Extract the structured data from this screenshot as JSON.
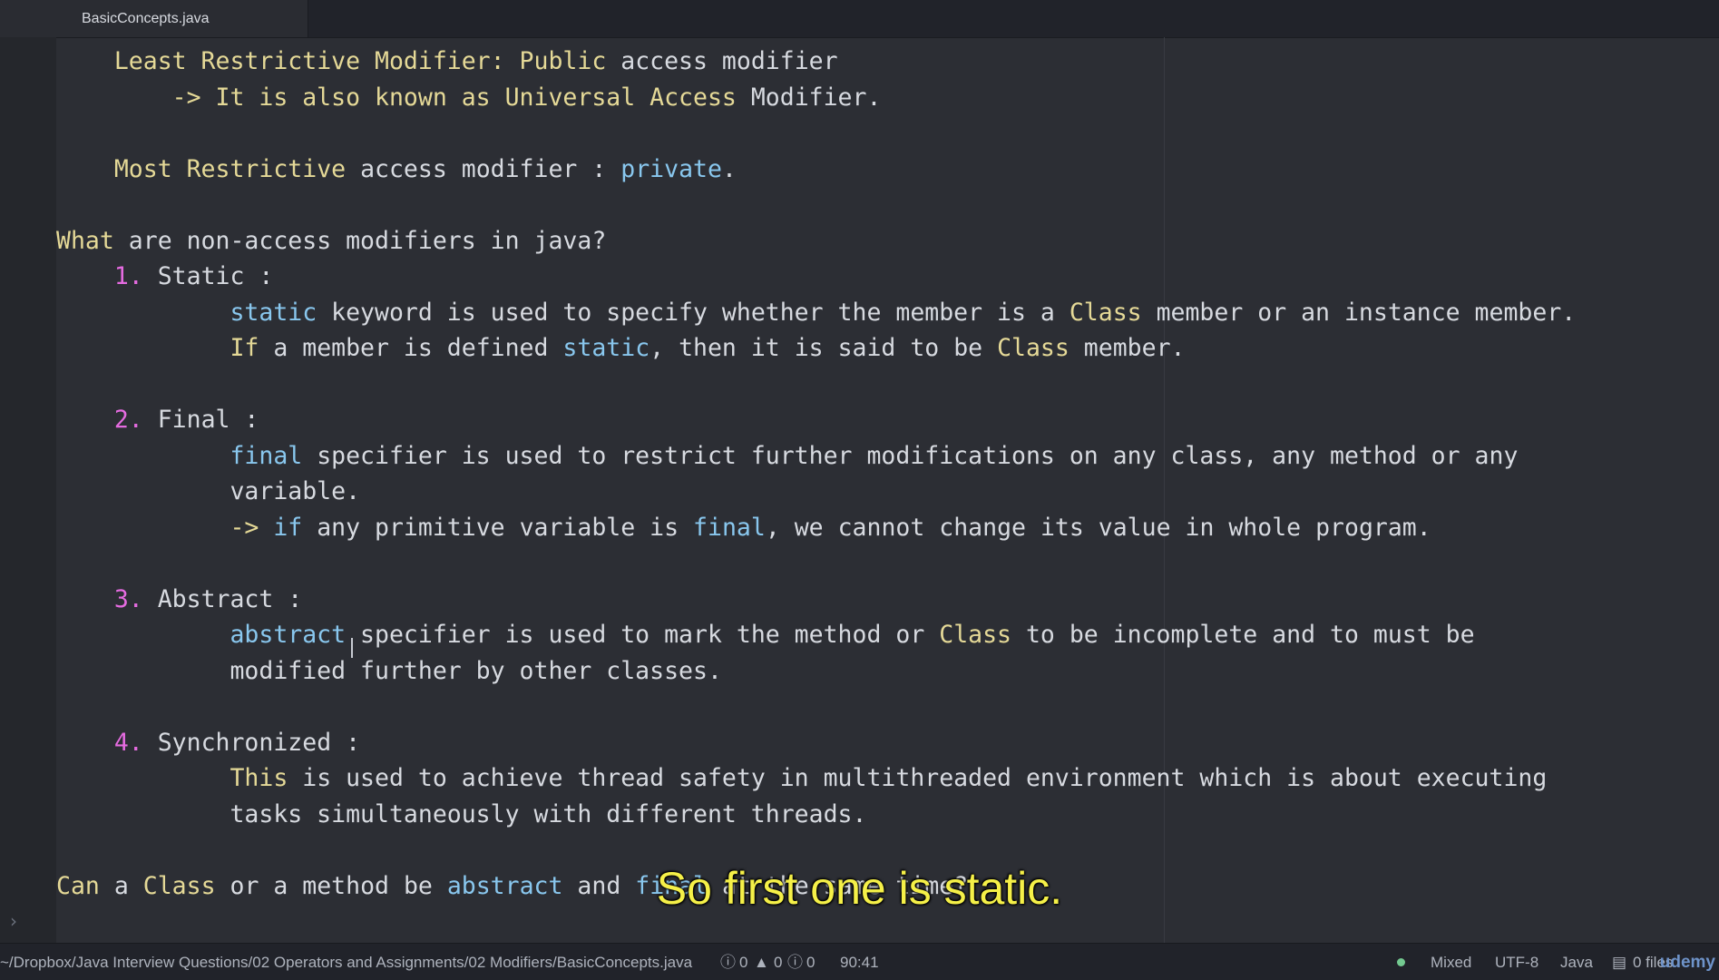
{
  "tab": {
    "title": "BasicConcepts.java"
  },
  "editor": {
    "lines": [
      {
        "segments": [
          {
            "t": "    ",
            "c": "def"
          },
          {
            "t": "Least Restrictive Modifier: Public",
            "c": "yel"
          },
          {
            "t": " access modifier",
            "c": "def"
          }
        ]
      },
      {
        "segments": [
          {
            "t": "        -> It is also known as ",
            "c": "yel"
          },
          {
            "t": "Universal Access",
            "c": "yel"
          },
          {
            "t": " Modifier.",
            "c": "def"
          }
        ]
      },
      {
        "segments": []
      },
      {
        "segments": [
          {
            "t": "    ",
            "c": "def"
          },
          {
            "t": "Most Restrictive",
            "c": "yel"
          },
          {
            "t": " access modifier : ",
            "c": "def"
          },
          {
            "t": "private",
            "c": "blue"
          },
          {
            "t": ".",
            "c": "def"
          }
        ]
      },
      {
        "segments": []
      },
      {
        "segments": [
          {
            "t": "What",
            "c": "yel"
          },
          {
            "t": " are non-access modifiers in java?",
            "c": "def"
          }
        ]
      },
      {
        "segments": [
          {
            "t": "    ",
            "c": "def"
          },
          {
            "t": "1.",
            "c": "pink"
          },
          {
            "t": " Static :",
            "c": "def"
          }
        ]
      },
      {
        "segments": [
          {
            "t": "            ",
            "c": "def"
          },
          {
            "t": "static",
            "c": "blue"
          },
          {
            "t": " keyword is used to specify whether the member is a ",
            "c": "def"
          },
          {
            "t": "Class",
            "c": "yel"
          },
          {
            "t": " member or an instance member.",
            "c": "def"
          }
        ]
      },
      {
        "segments": [
          {
            "t": "            ",
            "c": "def"
          },
          {
            "t": "If",
            "c": "yel"
          },
          {
            "t": " a member is defined ",
            "c": "def"
          },
          {
            "t": "static",
            "c": "blue"
          },
          {
            "t": ", then it is said to be ",
            "c": "def"
          },
          {
            "t": "Class",
            "c": "yel"
          },
          {
            "t": " member.",
            "c": "def"
          }
        ]
      },
      {
        "segments": []
      },
      {
        "segments": [
          {
            "t": "    ",
            "c": "def"
          },
          {
            "t": "2.",
            "c": "pink"
          },
          {
            "t": " Final :",
            "c": "def"
          }
        ]
      },
      {
        "segments": [
          {
            "t": "            ",
            "c": "def"
          },
          {
            "t": "final",
            "c": "blue"
          },
          {
            "t": " specifier is used to restrict further modifications on any class, any method or any",
            "c": "def"
          }
        ]
      },
      {
        "segments": [
          {
            "t": "            variable.",
            "c": "def"
          }
        ]
      },
      {
        "segments": [
          {
            "t": "            -> ",
            "c": "yel"
          },
          {
            "t": "if",
            "c": "blue"
          },
          {
            "t": " any primitive variable is ",
            "c": "def"
          },
          {
            "t": "final",
            "c": "blue"
          },
          {
            "t": ", we cannot change its value in whole program.",
            "c": "def"
          }
        ]
      },
      {
        "segments": []
      },
      {
        "segments": [
          {
            "t": "    ",
            "c": "def"
          },
          {
            "t": "3.",
            "c": "pink"
          },
          {
            "t": " Abstract :",
            "c": "def"
          }
        ]
      },
      {
        "segments": [
          {
            "t": "            ",
            "c": "def"
          },
          {
            "t": "abstract",
            "c": "blue"
          },
          {
            "t": " specifier is used to mark the method or ",
            "c": "def"
          },
          {
            "t": "Class",
            "c": "yel"
          },
          {
            "t": " to be incomplete and to must be",
            "c": "def"
          }
        ]
      },
      {
        "segments": [
          {
            "t": "            modified further by other classes.",
            "c": "def"
          }
        ]
      },
      {
        "segments": []
      },
      {
        "segments": [
          {
            "t": "    ",
            "c": "def"
          },
          {
            "t": "4.",
            "c": "pink"
          },
          {
            "t": " Synchronized :",
            "c": "def"
          }
        ]
      },
      {
        "segments": [
          {
            "t": "            ",
            "c": "def"
          },
          {
            "t": "This",
            "c": "yel"
          },
          {
            "t": " is used to achieve thread safety in multithreaded environment which is about executing",
            "c": "def"
          }
        ]
      },
      {
        "segments": [
          {
            "t": "            tasks simultaneously with different threads.",
            "c": "def"
          }
        ]
      },
      {
        "segments": []
      },
      {
        "segments": [
          {
            "t": "Can",
            "c": "yel"
          },
          {
            "t": " a ",
            "c": "def"
          },
          {
            "t": "Class",
            "c": "yel"
          },
          {
            "t": " or a method be ",
            "c": "def"
          },
          {
            "t": "abstract",
            "c": "blue"
          },
          {
            "t": " and ",
            "c": "def"
          },
          {
            "t": "final",
            "c": "blue"
          },
          {
            "t": " at the same time?",
            "c": "def"
          }
        ]
      }
    ]
  },
  "subtitle": "So first one is static.",
  "statusbar": {
    "path": "~/Dropbox/Java Interview Questions/02 Operators and Assignments/02 Modifiers/BasicConcepts.java",
    "errors": "0",
    "warnings": "0",
    "infos": "0",
    "cursor": "90:41",
    "line_ending": "Mixed",
    "encoding": "UTF-8",
    "grammar": "Java",
    "files": "0 files",
    "watermark": "udemy"
  },
  "icons": {
    "fold": "chevron-right-icon",
    "error": "circle-exclamation-icon",
    "warning": "triangle-warning-icon",
    "info": "circle-info-icon",
    "git": "clipboard-icon"
  },
  "colors": {
    "background": "#2c2e34",
    "keyword_yellow": "#e5d997",
    "keyword_blue": "#89c7ee",
    "number_pink": "#e56be0",
    "subtitle": "#f5f048",
    "status_ok": "#73c990"
  }
}
